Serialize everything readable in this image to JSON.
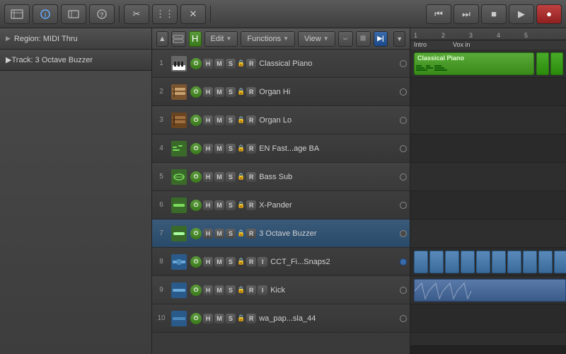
{
  "toolbar": {
    "rewind_label": "⏮",
    "forward_label": "⏭",
    "stop_label": "■",
    "play_label": "▶",
    "record_label": "●"
  },
  "left_panel": {
    "region_label": "Region: MIDI Thru",
    "track_label": "Track: 3 Octave Buzzer"
  },
  "tracks_toolbar": {
    "edit_label": "Edit",
    "functions_label": "Functions",
    "view_label": "View"
  },
  "tracks": [
    {
      "num": "1",
      "name": "Classical Piano",
      "icon_type": "piano",
      "has_i": false,
      "dot_type": "empty"
    },
    {
      "num": "2",
      "name": "Organ Hi",
      "icon_type": "organ",
      "has_i": false,
      "dot_type": "empty"
    },
    {
      "num": "3",
      "name": "Organ Lo",
      "icon_type": "organ2",
      "has_i": false,
      "dot_type": "empty"
    },
    {
      "num": "4",
      "name": "EN Fast...age BA",
      "icon_type": "synth",
      "has_i": false,
      "dot_type": "empty"
    },
    {
      "num": "5",
      "name": "Bass Sub",
      "icon_type": "bass",
      "has_i": false,
      "dot_type": "empty"
    },
    {
      "num": "6",
      "name": "X-Pander",
      "icon_type": "bass2",
      "has_i": false,
      "dot_type": "empty"
    },
    {
      "num": "7",
      "name": "3 Octave Buzzer",
      "icon_type": "synth2",
      "has_i": false,
      "dot_type": "filled"
    },
    {
      "num": "8",
      "name": "CCT_Fi...Snaps2",
      "icon_type": "audio",
      "has_i": true,
      "dot_type": "blue"
    },
    {
      "num": "9",
      "name": "Kick",
      "icon_type": "audio2",
      "has_i": true,
      "dot_type": "empty"
    },
    {
      "num": "10",
      "name": "wa_pap...sla_44",
      "icon_type": "audio3",
      "has_i": false,
      "dot_type": "empty"
    }
  ],
  "ruler": {
    "marks": [
      "1",
      "2",
      "3",
      "4",
      "5"
    ]
  },
  "regions": {
    "intro_label": "Intro",
    "vox_in_label": "Vox in"
  },
  "colors": {
    "green": "#4a8a2a",
    "blue": "#2a5a9a",
    "accent": "#e0a020"
  }
}
